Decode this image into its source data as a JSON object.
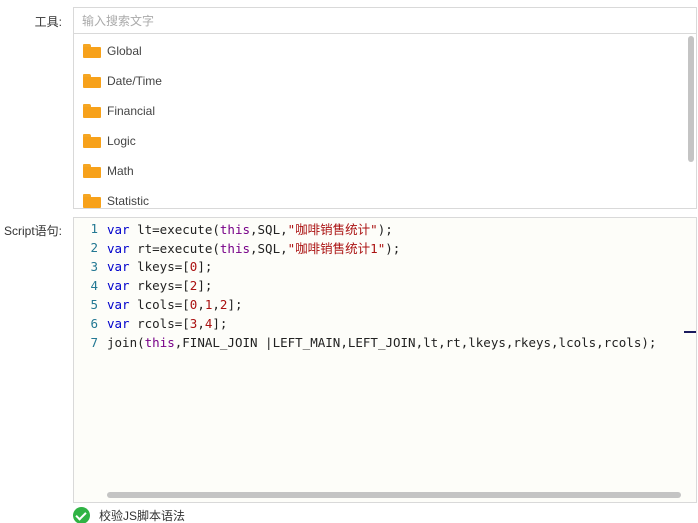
{
  "form": {
    "tools_label": "工具:",
    "script_label": "Script语句:",
    "search_placeholder": "输入搜索文字"
  },
  "tree": {
    "items": [
      {
        "label": "Global",
        "icon": "folder-icon"
      },
      {
        "label": "Date/Time",
        "icon": "folder-icon"
      },
      {
        "label": "Financial",
        "icon": "folder-icon"
      },
      {
        "label": "Logic",
        "icon": "folder-icon"
      },
      {
        "label": "Math",
        "icon": "folder-icon"
      },
      {
        "label": "Statistic",
        "icon": "folder-icon"
      }
    ]
  },
  "editor": {
    "lines": [
      {
        "n": "1",
        "parts": [
          [
            "kw",
            "var"
          ],
          [
            "t",
            " lt=execute("
          ],
          [
            "th",
            "this"
          ],
          [
            "t",
            ",SQL,"
          ],
          [
            "str",
            "\"咖啡销售统计\""
          ],
          [
            "t",
            ");"
          ]
        ]
      },
      {
        "n": "2",
        "parts": [
          [
            "kw",
            "var"
          ],
          [
            "t",
            " rt=execute("
          ],
          [
            "th",
            "this"
          ],
          [
            "t",
            ",SQL,"
          ],
          [
            "str",
            "\"咖啡销售统计1\""
          ],
          [
            "t",
            ");"
          ]
        ]
      },
      {
        "n": "3",
        "parts": [
          [
            "kw",
            "var"
          ],
          [
            "t",
            " lkeys=["
          ],
          [
            "num",
            "0"
          ],
          [
            "t",
            "];"
          ]
        ]
      },
      {
        "n": "4",
        "parts": [
          [
            "kw",
            "var"
          ],
          [
            "t",
            " rkeys=["
          ],
          [
            "num",
            "2"
          ],
          [
            "t",
            "];"
          ]
        ]
      },
      {
        "n": "5",
        "parts": [
          [
            "kw",
            "var"
          ],
          [
            "t",
            " lcols=["
          ],
          [
            "num",
            "0"
          ],
          [
            "t",
            ","
          ],
          [
            "num",
            "1"
          ],
          [
            "t",
            ","
          ],
          [
            "num",
            "2"
          ],
          [
            "t",
            "];"
          ]
        ]
      },
      {
        "n": "6",
        "parts": [
          [
            "kw",
            "var"
          ],
          [
            "t",
            " rcols=["
          ],
          [
            "num",
            "3"
          ],
          [
            "t",
            ","
          ],
          [
            "num",
            "4"
          ],
          [
            "t",
            "];"
          ]
        ]
      },
      {
        "n": "7",
        "parts": [
          [
            "t",
            "join("
          ],
          [
            "th",
            "this"
          ],
          [
            "t",
            ",FINAL_JOIN |LEFT_MAIN,LEFT_JOIN,lt,rt,lkeys,rkeys,lcols,rcols);"
          ]
        ]
      }
    ]
  },
  "validate": {
    "label": "校验JS脚本语法",
    "icon": "check-circle-icon",
    "color": "#2fb344"
  }
}
